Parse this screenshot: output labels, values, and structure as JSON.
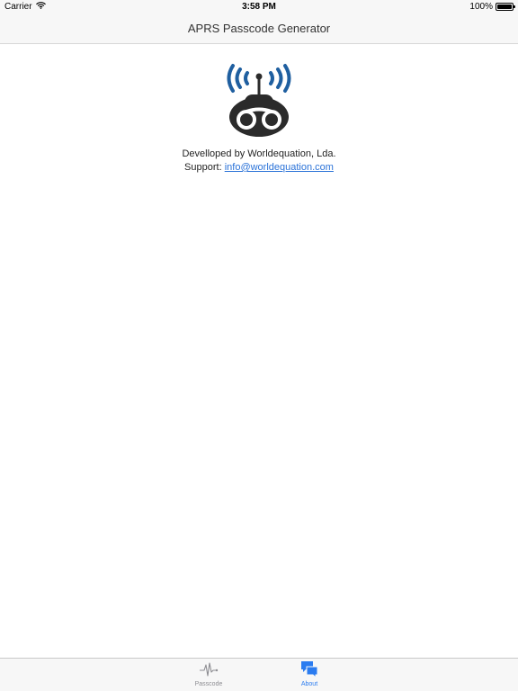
{
  "status_bar": {
    "carrier": "Carrier",
    "time": "3:58 PM",
    "battery": "100%"
  },
  "nav": {
    "title": "APRS Passcode Generator"
  },
  "about": {
    "developer_line": "Develloped by Worldequation, Lda.",
    "support_label": "Support:",
    "support_email": "info@worldequation.com"
  },
  "tabs": [
    {
      "label": "Passcode",
      "icon": "pulse-icon",
      "selected": false
    },
    {
      "label": "About",
      "icon": "chat-bubbles-icon",
      "selected": true
    }
  ],
  "colors": {
    "accent": "#2b7cf0",
    "link": "#2a72d8",
    "logo_waves": "#1f5fa0",
    "logo_body": "#2b2b2b",
    "inactive_tab": "#8e8e93"
  }
}
